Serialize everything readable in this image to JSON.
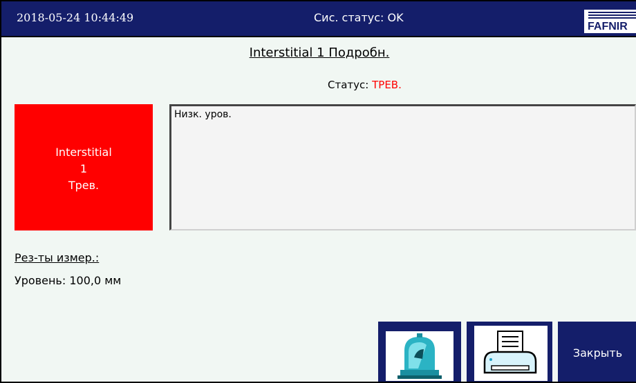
{
  "header": {
    "datetime": "2018-05-24  10:44:49",
    "system_status": "Сис. статус: OK",
    "logo_text": "FAFNIR"
  },
  "page": {
    "title": "Interstitial 1 Подробн.",
    "status_label": "Статус:",
    "status_value": "ТРЕВ."
  },
  "alarm_tile": {
    "line1": "Interstitial",
    "line2": "1",
    "line3": "Трев.",
    "color": "#ff0000"
  },
  "message_box": {
    "text": "Низк. уров."
  },
  "measurements": {
    "title": "Рез-ты измер.:",
    "level": "Уровень: 100,0 мм"
  },
  "buttons": {
    "siren_icon": "siren-icon",
    "print_icon": "printer-icon",
    "close_label": "Закрыть"
  },
  "colors": {
    "header_bg": "#141e6a",
    "background": "#f1f7f3",
    "alarm": "#ff0000"
  }
}
